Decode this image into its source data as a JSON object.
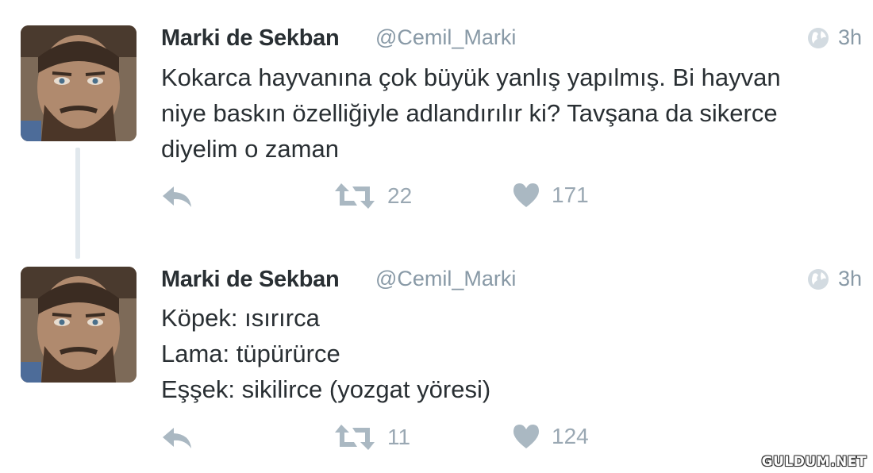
{
  "tweets": [
    {
      "name": "Marki de Sekban",
      "handle": "@Cemil_Marki",
      "time": "3h",
      "lines": [
        "Kokarca hayvanına çok büyük yanlış yapılmış. Bi hayvan",
        "niye baskın özelliğiyle adlandırılır ki? Tavşana da sikerce",
        "diyelim o zaman"
      ],
      "retweets": "22",
      "likes": "171"
    },
    {
      "name": "Marki de Sekban",
      "handle": "@Cemil_Marki",
      "time": "3h",
      "lines": [
        "Köpek: ısırırca",
        "Lama: tüpürürce",
        "Eşşek: sikilirce (yozgat yöresi)"
      ],
      "retweets": "11",
      "likes": "124"
    }
  ],
  "watermark": "GULDUM.NET",
  "colors": {
    "text": "#292f33",
    "muted": "#8899a6",
    "icon": "#aab8c2",
    "thread_line": "#e1e8ed"
  },
  "icons": [
    "globe-icon",
    "reply-icon",
    "retweet-icon",
    "heart-icon"
  ]
}
